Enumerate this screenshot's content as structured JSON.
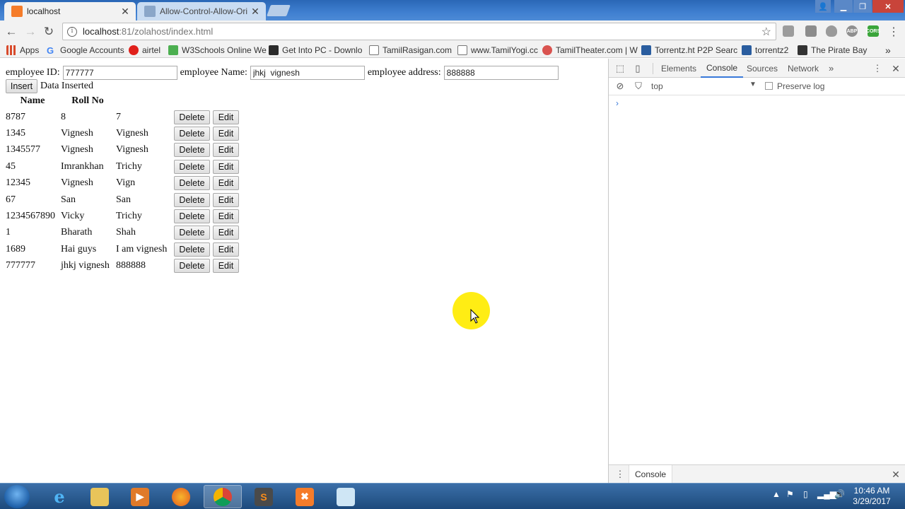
{
  "browser": {
    "tabs": [
      {
        "label": "localhost",
        "active": true
      },
      {
        "label": "Allow-Control-Allow-Ori",
        "active": false
      }
    ],
    "address": {
      "host": "localhost",
      "path": ":81/zolahost/index.html"
    },
    "bookmarks": [
      {
        "label": "Apps",
        "icon": "apps-grid-icon"
      },
      {
        "label": "Google Accounts",
        "icon": "google-icon"
      },
      {
        "label": "airtel",
        "icon": "airtel-icon"
      },
      {
        "label": "W3Schools Online We",
        "icon": "w3schools-icon"
      },
      {
        "label": "Get Into PC - Downlo",
        "icon": "getintopc-icon"
      },
      {
        "label": "TamilRasigan.com",
        "icon": "page-icon"
      },
      {
        "label": "www.TamilYogi.cc",
        "icon": "page-icon"
      },
      {
        "label": "TamilTheater.com | W",
        "icon": "tamiltheater-icon"
      },
      {
        "label": "Torrentz.ht P2P Searc",
        "icon": "torrentz-icon"
      },
      {
        "label": "torrentz2",
        "icon": "torrentz-icon"
      },
      {
        "label": "The Pirate Bay",
        "icon": "piratebay-icon"
      }
    ],
    "bookmarks_overflow": "»"
  },
  "page": {
    "form": {
      "id_label": "employee ID:",
      "id_value": "777777",
      "name_label": "employee Name:",
      "name_value": "jhkj  vignesh",
      "address_label": "employee address:",
      "address_value": "888888",
      "insert_label": "Insert",
      "status": "Data Inserted"
    },
    "table": {
      "headers": [
        "Name",
        "Roll No"
      ],
      "delete_label": "Delete",
      "edit_label": "Edit",
      "rows": [
        [
          "8787",
          "8",
          "7"
        ],
        [
          "1345",
          "Vignesh",
          "Vignesh"
        ],
        [
          "1345577",
          "Vignesh",
          "Vignesh"
        ],
        [
          "45",
          "Imrankhan",
          "Trichy"
        ],
        [
          "12345",
          "Vignesh",
          "Vign"
        ],
        [
          "67",
          "San",
          "San"
        ],
        [
          "1234567890",
          "Vicky",
          "Trichy"
        ],
        [
          "1",
          "Bharath",
          "Shah"
        ],
        [
          "1689",
          "Hai guys",
          "I am vignesh"
        ],
        [
          "777777",
          "jhkj vignesh",
          "888888"
        ]
      ]
    }
  },
  "devtools": {
    "tabs": [
      "Elements",
      "Console",
      "Sources",
      "Network"
    ],
    "active_tab": "Console",
    "more": "»",
    "context": "top",
    "preserve_log": "Preserve log",
    "prompt": "›",
    "drawer_tab": "Console"
  },
  "taskbar": {
    "time": "10:46 AM",
    "date": "3/29/2017"
  },
  "colors": {
    "accent": "#3879d9",
    "cursor_highlight": "#ffeb00",
    "title_bar": "#2a67b6"
  }
}
